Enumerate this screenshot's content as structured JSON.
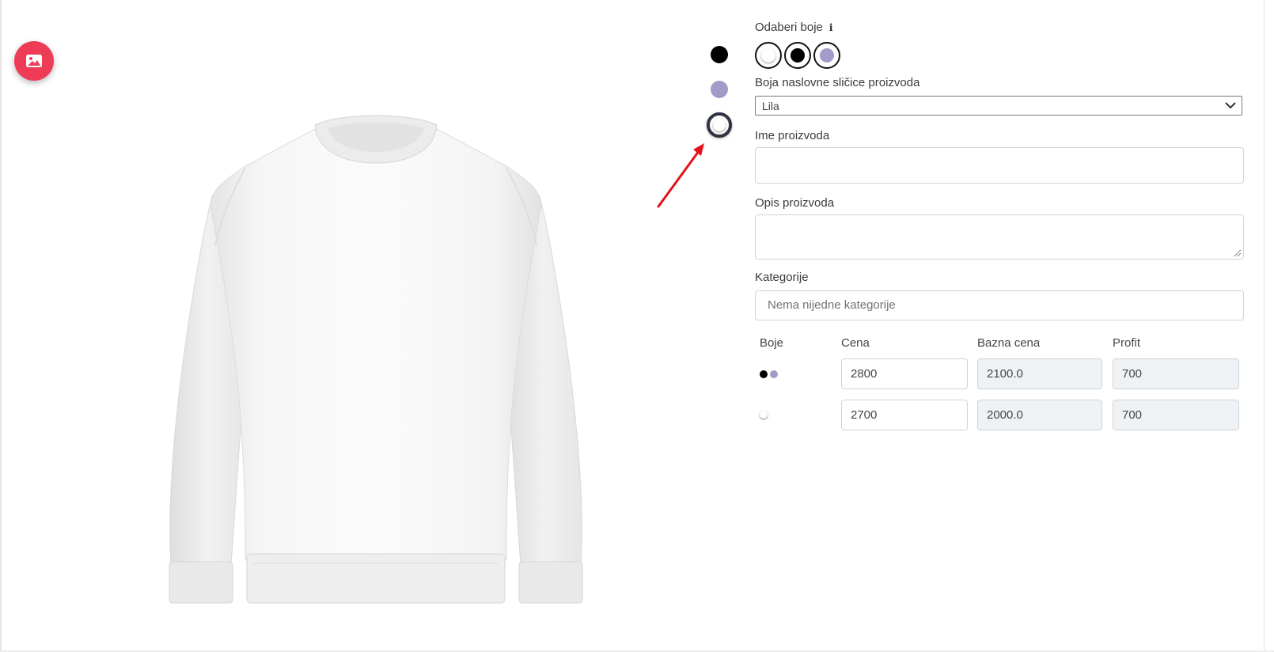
{
  "toolbar": {
    "image_button_icon": "image-icon"
  },
  "product_image": {
    "alt": "white crewneck sweatshirt"
  },
  "side_colors": [
    {
      "name": "black",
      "color": "#000000"
    },
    {
      "name": "lila",
      "color": "#a59bc9"
    },
    {
      "name": "white",
      "color": "#ffffff",
      "selected": true
    }
  ],
  "form": {
    "choose_colors_label": "Odaberi boje",
    "choose_colors_info_icon": "info-icon",
    "swatches": [
      {
        "name": "white",
        "color": "#ffffff"
      },
      {
        "name": "black",
        "color": "#000000"
      },
      {
        "name": "lila",
        "color": "#a59bc9"
      }
    ],
    "thumbnail_color_label": "Boja naslovne sličice proizvoda",
    "thumbnail_color_value": "Lila",
    "product_name_label": "Ime proizvoda",
    "product_name_value": "",
    "product_description_label": "Opis proizvoda",
    "product_description_value": "",
    "categories_label": "Kategorije",
    "categories_placeholder": "Nema nijedne kategorije"
  },
  "price_table": {
    "headers": [
      "Boje",
      "Cena",
      "Bazna cena",
      "Profit"
    ],
    "rows": [
      {
        "colors": [
          "#000000",
          "#a59bc9"
        ],
        "price": "2800",
        "base_price": "2100.0",
        "profit": "700"
      },
      {
        "colors": [
          "#ffffff"
        ],
        "price": "2700",
        "base_price": "2000.0",
        "profit": "700"
      }
    ]
  },
  "colors": {
    "accent": "#ee3b56",
    "lila": "#a59bc9",
    "input_border": "#cfd3d8",
    "readonly_bg": "#eff2f5"
  }
}
